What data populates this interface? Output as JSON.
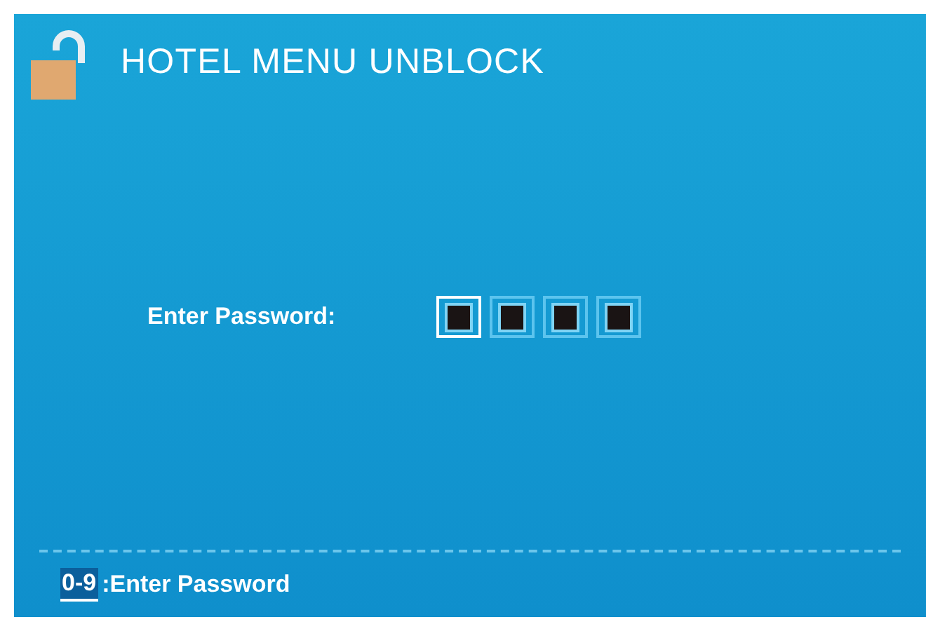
{
  "title": "HOTEL MENU UNBLOCK",
  "password": {
    "label": "Enter Password:",
    "slots": [
      {
        "selected": true
      },
      {
        "selected": false
      },
      {
        "selected": false
      },
      {
        "selected": false
      }
    ]
  },
  "hint": {
    "key": "0-9",
    "text": ":Enter Password"
  }
}
